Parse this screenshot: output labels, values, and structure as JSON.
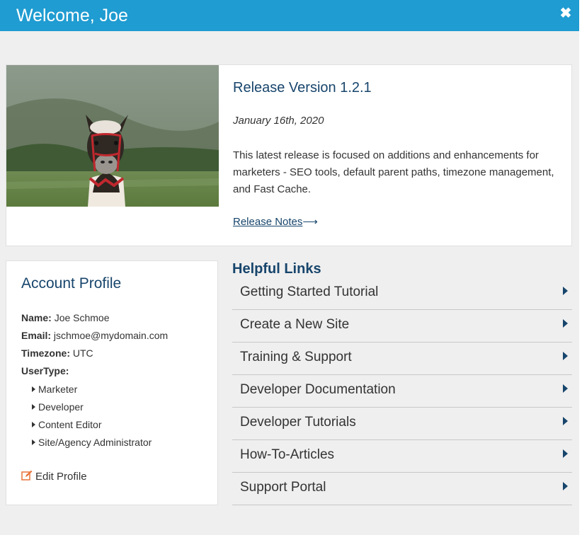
{
  "header": {
    "title": "Welcome, Joe",
    "close_label": "✖"
  },
  "release": {
    "title": "Release Version 1.2.1",
    "date": "January 16th, 2020",
    "description": "This latest release is focused on additions and enhancements for marketers - SEO tools, default parent paths, timezone management, and Fast Cache.",
    "link_label": "Release Notes",
    "link_arrow": "⟶"
  },
  "profile": {
    "title": "Account Profile",
    "name_label": "Name:",
    "name_value": "Joe Schmoe",
    "email_label": "Email:",
    "email_value": "jschmoe@mydomain.com",
    "timezone_label": "Timezone:",
    "timezone_value": "UTC",
    "usertype_label": "UserType:",
    "usertypes": [
      "Marketer",
      "Developer",
      "Content Editor",
      "Site/Agency Administrator"
    ],
    "edit_label": "Edit Profile"
  },
  "helpful_links": {
    "heading": "Helpful Links",
    "items": [
      "Getting Started Tutorial",
      "Create a New Site",
      "Training & Support",
      "Developer Documentation",
      "Developer Tutorials",
      "How-To-Articles",
      "Support Portal"
    ]
  },
  "colors": {
    "header_bg": "#1f9cd1",
    "accent": "#17456c",
    "edit_icon": "#e8743b"
  },
  "icons": {
    "close": "close-icon",
    "edit": "edit-icon",
    "caret": "caret-right-icon",
    "arrow": "arrow-right-icon"
  }
}
